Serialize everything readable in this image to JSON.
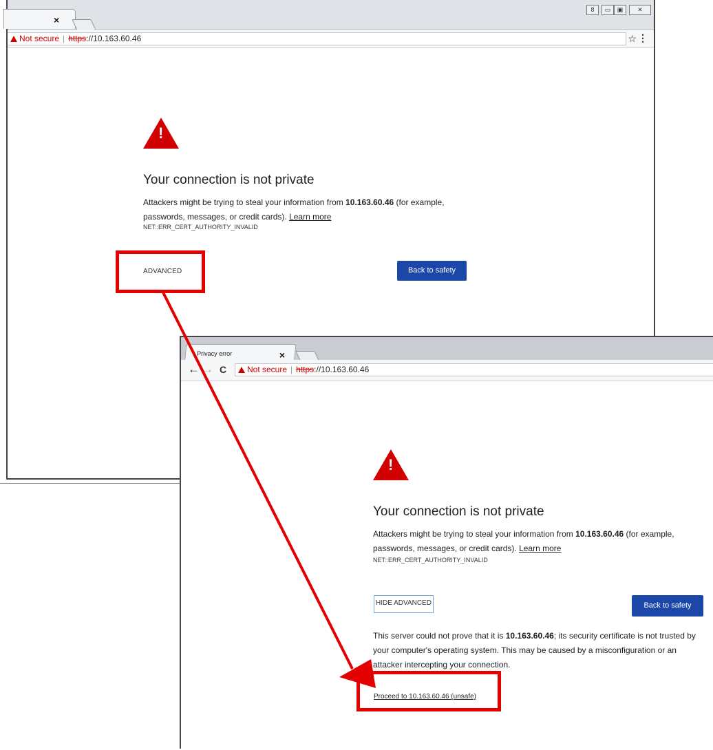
{
  "back_window": {
    "tab_close": "×",
    "window_controls": [
      "8",
      "▭",
      "▣",
      "✕"
    ],
    "omnibox": {
      "not_secure": "Not secure",
      "scheme": "https",
      "rest": "://10.163.60.46"
    },
    "star_icon": "☆",
    "menu_icon": "⋮",
    "error_page": {
      "heading": "Your connection is not private",
      "body_before": "Attackers might be trying to steal your information from ",
      "host_bold": "10.163.60.46",
      "body_after": " (for example, passwords, messages, or credit cards). ",
      "learn_more": "Learn more",
      "error_code": "NET::ERR_CERT_AUTHORITY_INVALID",
      "advanced_label": "ADVANCED",
      "back_label": "Back to safety"
    }
  },
  "front_window": {
    "tab_title": "Privacy error",
    "tab_close": "×",
    "nav": {
      "back": "←",
      "forward": "→",
      "reload": "C"
    },
    "omnibox": {
      "not_secure": "Not secure",
      "scheme": "https",
      "rest": "://10.163.60.46"
    },
    "error_page": {
      "heading": "Your connection is not private",
      "body_before": "Attackers might be trying to steal your information from ",
      "host_bold": "10.163.60.46",
      "body_after": " (for example, passwords, messages, or credit cards). ",
      "learn_more": "Learn more",
      "error_code": "NET::ERR_CERT_AUTHORITY_INVALID",
      "hide_advanced_label": "HIDE ADVANCED",
      "back_label": "Back to safety",
      "adv_before": "This server could not prove that it is ",
      "adv_host": "10.163.60.46",
      "adv_after": "; its security certificate is not trusted by your computer's operating system. This may be caused by a misconfiguration or an attacker intercepting your connection.",
      "proceed_label": "Proceed to 10.163.60.46 (unsafe)"
    }
  },
  "colors": {
    "annotation_red": "#e30000",
    "button_blue": "#1a47a8",
    "warning_red": "#d10000"
  }
}
